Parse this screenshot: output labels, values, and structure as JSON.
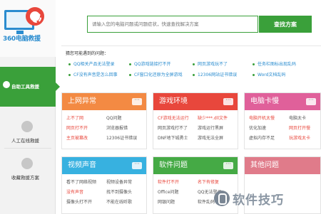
{
  "brand": {
    "logo_text": "360电脑救援"
  },
  "sidebar": {
    "items": [
      {
        "label": "自助工具救援",
        "active": true
      },
      {
        "label": "人工在线救援",
        "active": false
      },
      {
        "label": "收藏救援方案",
        "active": false
      }
    ]
  },
  "search": {
    "placeholder": "请输入您的电脑问题或问题症状，快速查找解决方案",
    "button_label": "查找方案"
  },
  "hints": {
    "title": "猜您可能遇到的问题：",
    "items": [
      "QQ相关产品无法登录",
      "QQ游戏链接打不开",
      "网页游戏玩不了",
      "任务栏图标出现乱码",
      "CF没有声音是怎么回事",
      "CF窗口化还原为全屏游戏",
      "12306网站证书错误",
      "Word文档乱码"
    ]
  },
  "cards": [
    {
      "id": "internet",
      "title": "上网异常",
      "color": "#f38a43",
      "cells": [
        {
          "text": "上不了网",
          "style": "red"
        },
        {
          "text": "QQ问题",
          "style": "gray"
        },
        {
          "text": "网页打不开",
          "style": "red"
        },
        {
          "text": "浏览器报错",
          "style": "gray"
        },
        {
          "text": "主页被篡改",
          "style": "red"
        },
        {
          "text": "12306证书错误",
          "style": "gray"
        }
      ]
    },
    {
      "id": "game",
      "title": "游戏环境",
      "color": "#e8473c",
      "cells": [
        {
          "text": "CF游戏无法运行",
          "style": "red"
        },
        {
          "text": "缺少***.dll文件",
          "style": "red"
        },
        {
          "text": "网页游戏打不了",
          "style": "gray"
        },
        {
          "text": "游戏运行黑屏",
          "style": "gray"
        },
        {
          "text": "DNF地下城勇士",
          "style": "gray"
        },
        {
          "text": "游戏无法全屏",
          "style": "gray"
        }
      ]
    },
    {
      "id": "pc",
      "title": "电脑卡慢",
      "color": "#e0609a",
      "cells": [
        {
          "text": "电脑开机太慢",
          "style": "red"
        },
        {
          "text": "电脑太卡",
          "style": "gray"
        },
        {
          "text": "优化加速",
          "style": "gray"
        },
        {
          "text": "网页打开慢",
          "style": "red"
        },
        {
          "text": "虚拟内存不足",
          "style": "gray"
        },
        {
          "text": "玩游戏太卡",
          "style": "red"
        }
      ]
    },
    {
      "id": "av",
      "title": "视频声音",
      "color": "#37b1e0",
      "cells": [
        {
          "text": "看不了网络视频",
          "style": "gray"
        },
        {
          "text": "视频设备异常",
          "style": "gray"
        },
        {
          "text": "没有声音",
          "style": "red"
        },
        {
          "text": "找不到摄像头",
          "style": "gray"
        },
        {
          "text": "摄像头打不开",
          "style": "gray"
        },
        {
          "text": "不能在线听歌",
          "style": "gray"
        }
      ]
    },
    {
      "id": "software",
      "title": "软件问题",
      "color": "#45aa45",
      "cells": [
        {
          "text": "软件打不开",
          "style": "red"
        },
        {
          "text": "名下有修复",
          "style": "red"
        },
        {
          "text": "Office问题",
          "style": "gray"
        },
        {
          "text": "QQ无法登录",
          "style": "gray"
        },
        {
          "text": "网银问题",
          "style": "gray"
        },
        {
          "text": "软件乱码",
          "style": "gray"
        }
      ]
    },
    {
      "id": "other",
      "title": "其他问题",
      "color": "#e07b8a",
      "cells": []
    }
  ],
  "watermark": {
    "text": "软件技巧"
  }
}
